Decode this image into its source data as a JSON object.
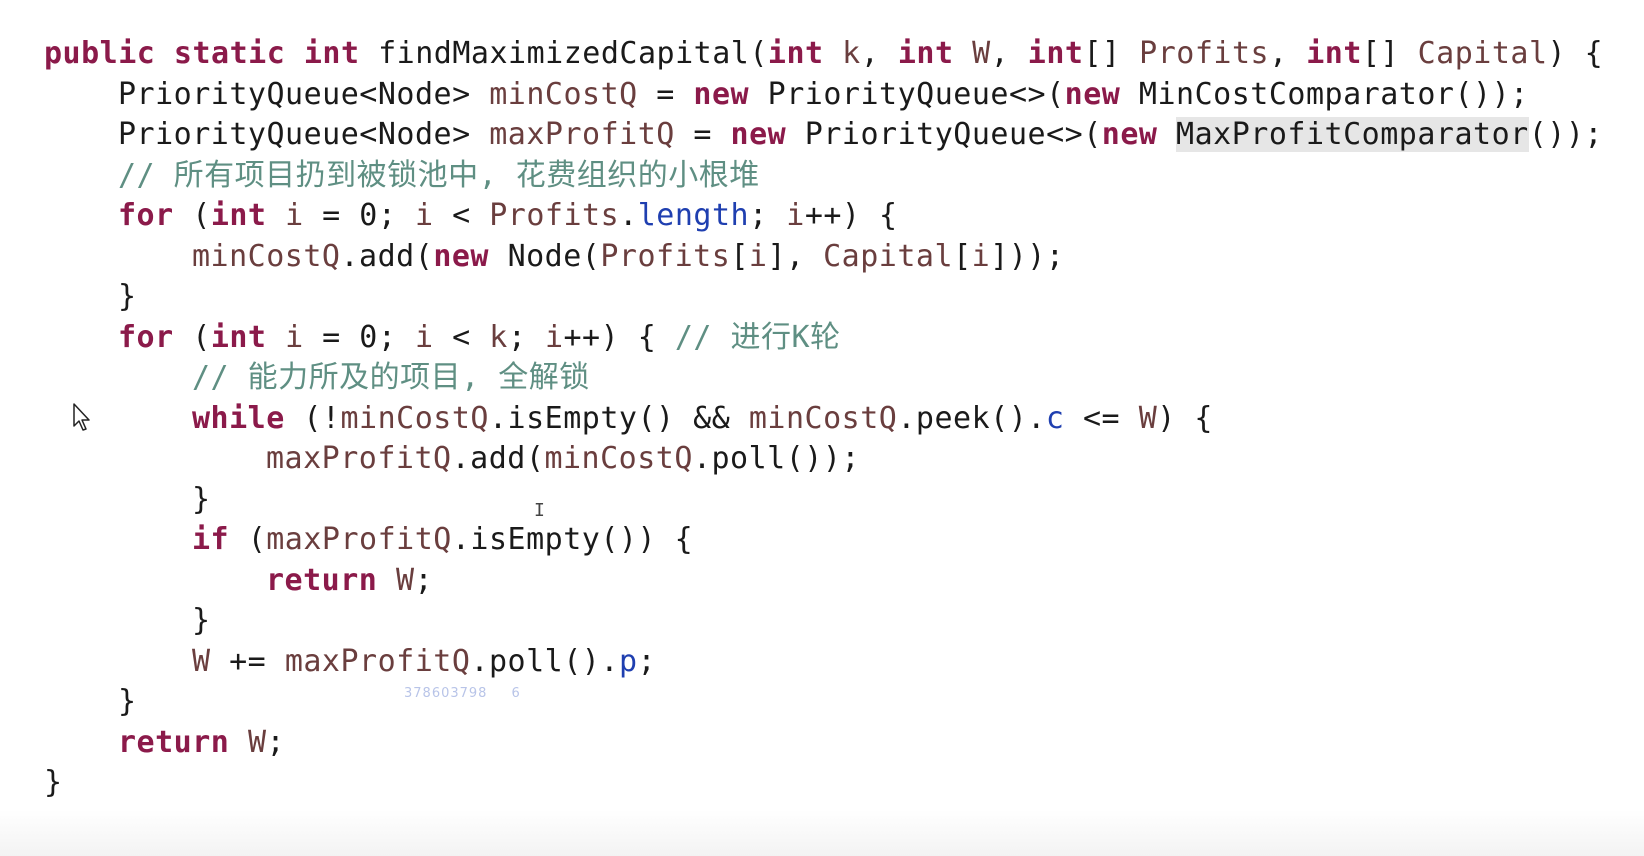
{
  "code_lines": [
    [
      [
        "kw",
        "public static int "
      ],
      [
        "plain",
        "findMaximizedCapital("
      ],
      [
        "kw",
        "int "
      ],
      [
        "var",
        "k"
      ],
      [
        "plain",
        ", "
      ],
      [
        "kw",
        "int "
      ],
      [
        "var",
        "W"
      ],
      [
        "plain",
        ", "
      ],
      [
        "kw",
        "int"
      ],
      [
        "plain",
        "[] "
      ],
      [
        "var",
        "Profits"
      ],
      [
        "plain",
        ", "
      ],
      [
        "kw",
        "int"
      ],
      [
        "plain",
        "[] "
      ],
      [
        "var",
        "Capital"
      ],
      [
        "plain",
        ") {"
      ]
    ],
    [
      [
        "plain",
        "PriorityQueue<Node> "
      ],
      [
        "var",
        "minCostQ"
      ],
      [
        "plain",
        " = "
      ],
      [
        "kw",
        "new "
      ],
      [
        "plain",
        "PriorityQueue<>("
      ],
      [
        "kw",
        "new "
      ],
      [
        "plain",
        "MinCostComparator());"
      ]
    ],
    [
      [
        "plain",
        "PriorityQueue<Node> "
      ],
      [
        "var",
        "maxProfitQ"
      ],
      [
        "plain",
        " = "
      ],
      [
        "kw",
        "new "
      ],
      [
        "plain",
        "PriorityQueue<>("
      ],
      [
        "kw",
        "new "
      ],
      [
        "hl",
        "MaxProfitComparator"
      ],
      [
        "plain",
        "());"
      ]
    ],
    [
      [
        "cmt",
        "// 所有项目扔到被锁池中, 花费组织的小根堆"
      ]
    ],
    [
      [
        "kw",
        "for "
      ],
      [
        "plain",
        "("
      ],
      [
        "kw",
        "int "
      ],
      [
        "var",
        "i"
      ],
      [
        "plain",
        " = 0; "
      ],
      [
        "var",
        "i"
      ],
      [
        "plain",
        " < "
      ],
      [
        "var",
        "Profits"
      ],
      [
        "plain",
        "."
      ],
      [
        "fld",
        "length"
      ],
      [
        "plain",
        "; "
      ],
      [
        "var",
        "i"
      ],
      [
        "plain",
        "++) {"
      ]
    ],
    [
      [
        "var",
        "minCostQ"
      ],
      [
        "plain",
        ".add("
      ],
      [
        "kw",
        "new "
      ],
      [
        "plain",
        "Node("
      ],
      [
        "var",
        "Profits"
      ],
      [
        "plain",
        "["
      ],
      [
        "var",
        "i"
      ],
      [
        "plain",
        "], "
      ],
      [
        "var",
        "Capital"
      ],
      [
        "plain",
        "["
      ],
      [
        "var",
        "i"
      ],
      [
        "plain",
        "]));"
      ]
    ],
    [
      [
        "plain",
        "}"
      ]
    ],
    [
      [
        "kw",
        "for "
      ],
      [
        "plain",
        "("
      ],
      [
        "kw",
        "int "
      ],
      [
        "var",
        "i"
      ],
      [
        "plain",
        " = 0; "
      ],
      [
        "var",
        "i"
      ],
      [
        "plain",
        " < "
      ],
      [
        "var",
        "k"
      ],
      [
        "plain",
        "; "
      ],
      [
        "var",
        "i"
      ],
      [
        "plain",
        "++) { "
      ],
      [
        "cmt",
        "// 进行K轮"
      ]
    ],
    [
      [
        "cmt",
        "// 能力所及的项目, 全解锁"
      ]
    ],
    [
      [
        "kw",
        "while "
      ],
      [
        "plain",
        "(!"
      ],
      [
        "var",
        "minCostQ"
      ],
      [
        "plain",
        ".isEmpty() && "
      ],
      [
        "var",
        "minCostQ"
      ],
      [
        "plain",
        ".peek()."
      ],
      [
        "fld",
        "c"
      ],
      [
        "plain",
        " <= "
      ],
      [
        "var",
        "W"
      ],
      [
        "plain",
        ") {"
      ]
    ],
    [
      [
        "var",
        "maxProfitQ"
      ],
      [
        "plain",
        ".add("
      ],
      [
        "var",
        "minCostQ"
      ],
      [
        "plain",
        ".poll());"
      ]
    ],
    [
      [
        "plain",
        "}"
      ]
    ],
    [
      [
        "kw",
        "if "
      ],
      [
        "plain",
        "("
      ],
      [
        "var",
        "maxProfitQ"
      ],
      [
        "plain",
        ".isEmpty()) {"
      ]
    ],
    [
      [
        "kw",
        "return "
      ],
      [
        "var",
        "W"
      ],
      [
        "plain",
        ";"
      ]
    ],
    [
      [
        "plain",
        "}"
      ]
    ],
    [
      [
        "var",
        "W"
      ],
      [
        "plain",
        " += "
      ],
      [
        "var",
        "maxProfitQ"
      ],
      [
        "plain",
        ".poll()."
      ],
      [
        "fld",
        "p"
      ],
      [
        "plain",
        ";"
      ]
    ],
    [
      [
        "plain",
        "}"
      ]
    ],
    [
      [
        "kw",
        "return "
      ],
      [
        "var",
        "W"
      ],
      [
        "plain",
        ";"
      ]
    ],
    [
      [
        "plain",
        "}"
      ]
    ]
  ],
  "watermark": {
    "id_text": "378603798",
    "suffix": "6"
  },
  "colors": {
    "keyword": "#8b1a4a",
    "variable": "#6a3e3e",
    "field": "#1f3fb0",
    "comment": "#5f8f83",
    "plain": "#1a1a1a",
    "highlight": "#e6e6e6"
  },
  "icons": {
    "mouse_cursor": "arrow-cursor-icon",
    "text_cursor": "i-beam-cursor-icon"
  }
}
